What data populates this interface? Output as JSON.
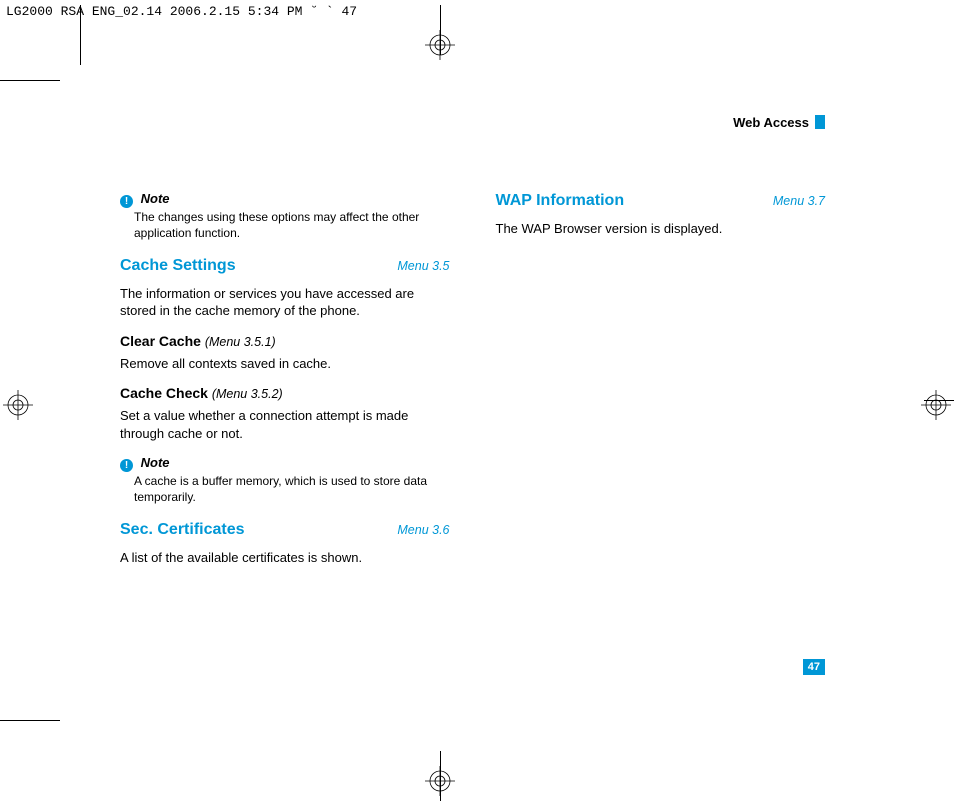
{
  "header_strip": "LG2000 RSA ENG_02.14  2006.2.15 5:34 PM  ˘  ` 47",
  "section_title": "Web Access",
  "page_number": "47",
  "left_col": {
    "note1": {
      "label": "Note",
      "text": "The changes using these options may affect the other application function."
    },
    "cache_settings": {
      "title": "Cache Settings",
      "menu": "Menu 3.5",
      "intro": "The information or services you have accessed are stored in the cache memory of the phone.",
      "clear_cache": {
        "title": "Clear Cache",
        "menu": "(Menu 3.5.1)",
        "body": "Remove all contexts saved in cache."
      },
      "cache_check": {
        "title": "Cache Check",
        "menu": "(Menu 3.5.2)",
        "body": "Set a value whether a connection attempt is made through cache or not."
      }
    },
    "note2": {
      "label": "Note",
      "text": "A cache is a buffer memory, which is used to store data temporarily."
    },
    "sec_certs": {
      "title": "Sec. Certificates",
      "menu": "Menu 3.6",
      "body": "A list of the available certificates is shown."
    }
  },
  "right_col": {
    "wap_info": {
      "title": "WAP Information",
      "menu": "Menu 3.7",
      "body": "The WAP Browser version is displayed."
    }
  }
}
